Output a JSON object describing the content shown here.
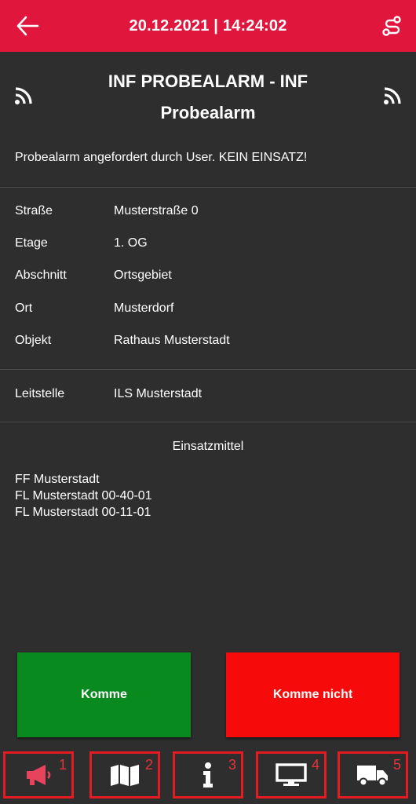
{
  "header": {
    "datetime": "20.12.2021 | 14:24:02",
    "bg_color": "#e0163d"
  },
  "alarm": {
    "title": "INF PROBEALARM - INF Probealarm",
    "message": "Probealarm angefordert durch User. KEIN EINSATZ!"
  },
  "location": [
    {
      "label": "Straße",
      "value": "Musterstraße 0"
    },
    {
      "label": "Etage",
      "value": "1. OG"
    },
    {
      "label": "Abschnitt",
      "value": "Ortsgebiet"
    },
    {
      "label": "Ort",
      "value": "Musterdorf"
    },
    {
      "label": "Objekt",
      "value": "Rathaus Musterstadt"
    }
  ],
  "control": {
    "label": "Leitstelle",
    "value": "ILS Musterstadt"
  },
  "resources": {
    "heading": "Einsatzmittel",
    "items": [
      "FF Musterstadt",
      "FL Musterstadt 00-40-01",
      "FL Musterstadt 00-11-01"
    ]
  },
  "actions": {
    "komme": "Komme",
    "komme_nicht": "Komme nicht",
    "komme_color": "#088a1e",
    "komme_nicht_color": "#f70a0a"
  },
  "tabs": [
    {
      "number": "1",
      "icon": "megaphone-icon",
      "active": true
    },
    {
      "number": "2",
      "icon": "map-icon",
      "active": false
    },
    {
      "number": "3",
      "icon": "info-icon",
      "active": false
    },
    {
      "number": "4",
      "icon": "monitor-icon",
      "active": false
    },
    {
      "number": "5",
      "icon": "truck-icon",
      "active": false
    }
  ]
}
